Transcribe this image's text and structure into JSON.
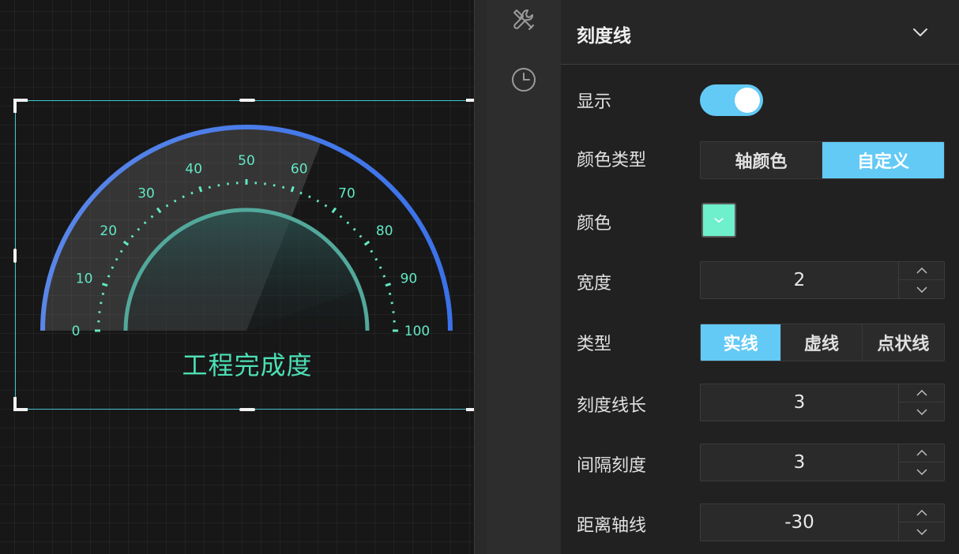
{
  "gauge": {
    "title": "工程完成度",
    "tick_labels": [
      "0",
      "10",
      "20",
      "30",
      "40",
      "50",
      "60",
      "70",
      "80",
      "90",
      "100"
    ],
    "min": 0,
    "max": 100,
    "highlight_value": 62,
    "arc_color": "#3f7ef0",
    "tick_color": "#63e8c3",
    "inner_arc_color": "#52a89b"
  },
  "rail": {
    "icons": [
      "wrench-screwdriver-icon",
      "clock-icon"
    ]
  },
  "panel": {
    "title": "刻度线",
    "rows": {
      "show": {
        "label": "显示",
        "enabled": true
      },
      "color_type": {
        "label": "颜色类型",
        "options": [
          "轴颜色",
          "自定义"
        ],
        "selected": "自定义"
      },
      "color": {
        "label": "颜色",
        "value": "#6ef0cc"
      },
      "width": {
        "label": "宽度",
        "value": "2"
      },
      "type": {
        "label": "类型",
        "options": [
          "实线",
          "虚线",
          "点状线"
        ],
        "selected": "实线"
      },
      "tick_length": {
        "label": "刻度线长",
        "value": "3"
      },
      "interval": {
        "label": "间隔刻度",
        "value": "3"
      },
      "axis_distance": {
        "label": "距离轴线",
        "value": "-30"
      }
    }
  },
  "colors": {
    "accent": "#63caf5",
    "selection": "#45c4cf"
  }
}
